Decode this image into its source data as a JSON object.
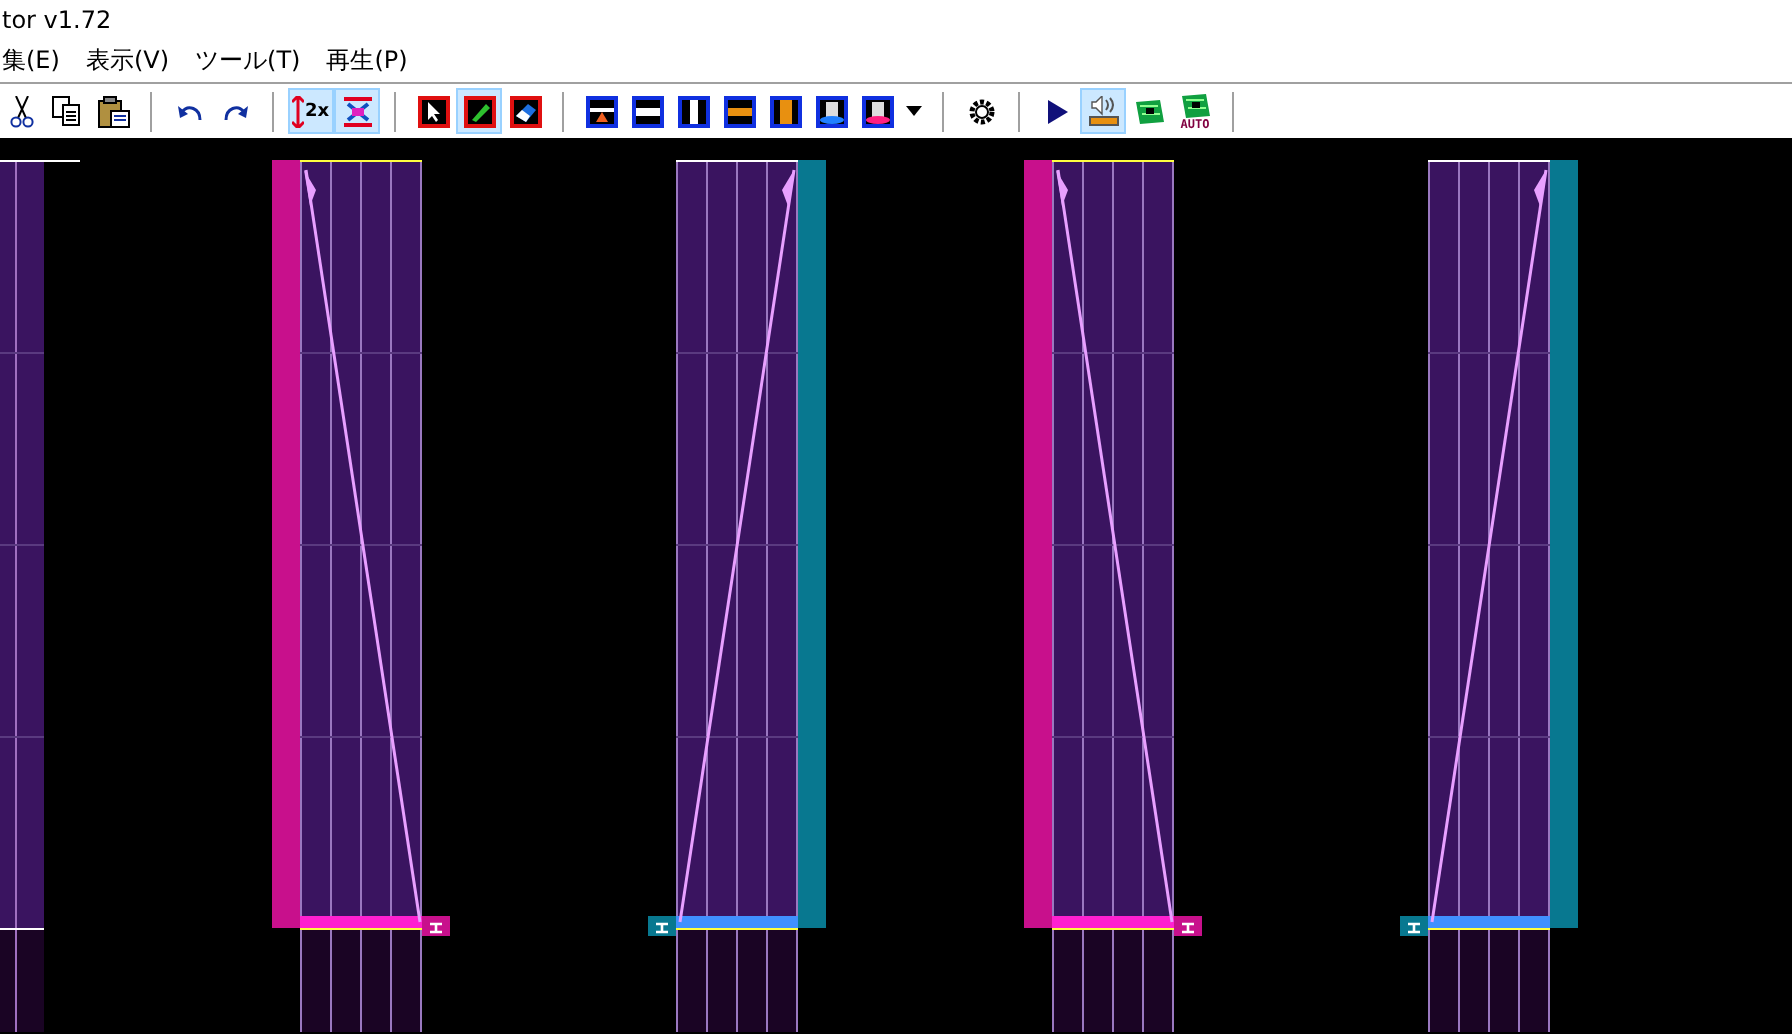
{
  "window": {
    "title": "tor v1.72"
  },
  "menu": [
    {
      "label": "集(E)"
    },
    {
      "label": "表示(V)"
    },
    {
      "label": "ツール(T)"
    },
    {
      "label": "再生(P)"
    }
  ],
  "toolbar": [
    [
      {
        "kind": "cut",
        "selected": false
      },
      {
        "kind": "copy",
        "selected": false
      },
      {
        "kind": "paste",
        "selected": false
      }
    ],
    [
      {
        "kind": "undo",
        "selected": false
      },
      {
        "kind": "redo",
        "selected": false
      }
    ],
    [
      {
        "kind": "speed",
        "label": "2x",
        "selected": true
      },
      {
        "kind": "overlap",
        "selected": true
      }
    ],
    [
      {
        "kind": "pointer",
        "selected": false
      },
      {
        "kind": "pencil",
        "selected": true
      },
      {
        "kind": "eraser",
        "selected": false
      }
    ],
    [
      {
        "kind": "hbar-tri",
        "selected": false
      },
      {
        "kind": "hbar",
        "selected": false
      },
      {
        "kind": "vbar",
        "selected": false
      },
      {
        "kind": "hbar-orange",
        "selected": false
      },
      {
        "kind": "vbar-orange",
        "selected": false
      },
      {
        "kind": "cyl-blue",
        "selected": false
      },
      {
        "kind": "cyl-pink",
        "selected": false
      },
      {
        "kind": "caret",
        "selected": false
      }
    ],
    [
      {
        "kind": "gear",
        "selected": false
      }
    ],
    [
      {
        "kind": "play",
        "selected": false
      },
      {
        "kind": "sound",
        "selected": true
      },
      {
        "kind": "film",
        "selected": false
      },
      {
        "kind": "film-auto",
        "label": "AUTO",
        "selected": false
      }
    ]
  ],
  "slides": [
    {
      "kind": "left",
      "color": "#c8108c"
    },
    {
      "kind": "right",
      "color": "#087890"
    },
    {
      "kind": "left",
      "color": "#c8108c"
    },
    {
      "kind": "right",
      "color": "#087890"
    }
  ]
}
